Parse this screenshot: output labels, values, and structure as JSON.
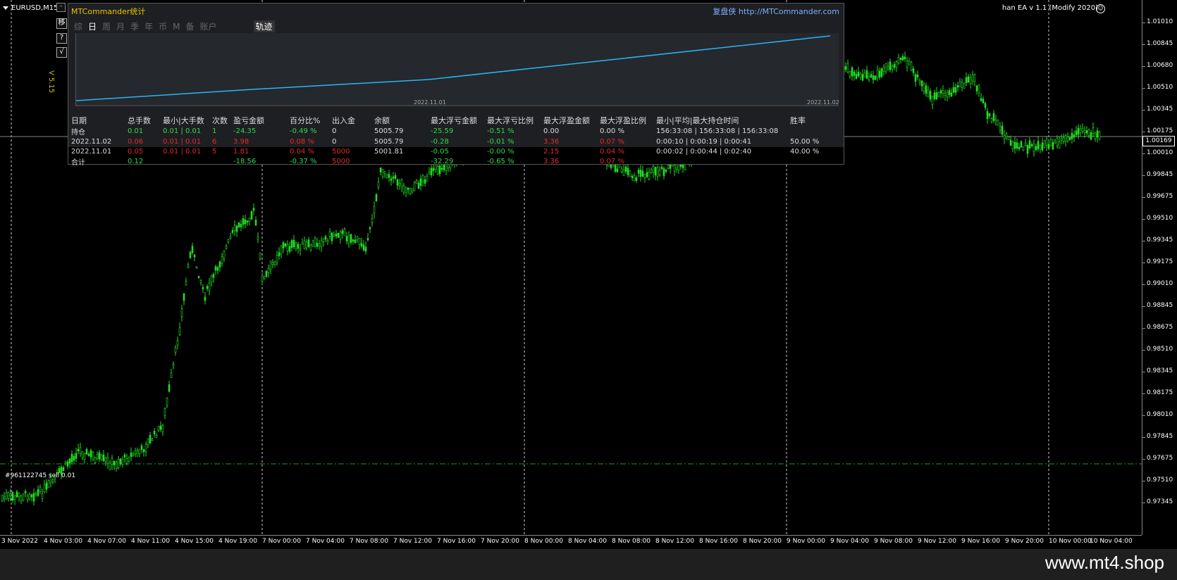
{
  "chart": {
    "symbol": "EURUSD,M15",
    "ea_label": "han EA  v 1.1 (Modify 2020)",
    "version": "V 5.15",
    "order_label": "#961122745 sell 0.01",
    "current_price": "1.00169",
    "price_ticks": [
      "1.01010",
      "1.00845",
      "1.00680",
      "1.00510",
      "1.00345",
      "1.00175",
      "1.00010",
      "0.99845",
      "0.99675",
      "0.99510",
      "0.99345",
      "0.99175",
      "0.99010",
      "0.98845",
      "0.98675",
      "0.98510",
      "0.98345",
      "0.98175",
      "0.98010",
      "0.97845",
      "0.97675",
      "0.97510",
      "0.97345"
    ],
    "time_ticks": [
      "3 Nov 2022",
      "4 Nov 03:00",
      "4 Nov 07:00",
      "4 Nov 11:00",
      "4 Nov 15:00",
      "4 Nov 19:00",
      "7 Nov 00:00",
      "7 Nov 04:00",
      "7 Nov 08:00",
      "7 Nov 12:00",
      "7 Nov 16:00",
      "7 Nov 20:00",
      "8 Nov 00:00",
      "8 Nov 04:00",
      "8 Nov 08:00",
      "8 Nov 12:00",
      "8 Nov 16:00",
      "8 Nov 20:00",
      "9 Nov 00:00",
      "9 Nov 04:00",
      "9 Nov 08:00",
      "9 Nov 12:00",
      "9 Nov 16:00",
      "9 Nov 20:00",
      "10 Nov 00:00",
      "10 Nov 04:00"
    ],
    "colors": {
      "candle": "#22dd22",
      "axis": "#888888",
      "order_line": "#2a8f2a"
    }
  },
  "side_buttons": [
    "移",
    "?",
    "√"
  ],
  "panel": {
    "title": "MTCommander统计",
    "site": "复盘侠 http://MTCommander.com",
    "tabs": [
      "综",
      "日",
      "周",
      "月",
      "季",
      "年",
      "币",
      "M",
      "备",
      "账户"
    ],
    "active_tab": "日",
    "track_tab": "轨迹",
    "mini_dates": [
      "2022.11.01",
      "2022.11.02"
    ],
    "line_color": "#29b6f6",
    "headers": [
      "日期",
      "总手数",
      "最小|大手数",
      "次数",
      "盈亏金额",
      "百分比%",
      "出入金",
      "余额",
      "最大浮亏金额",
      "最大浮亏比例",
      "最大浮盈金额",
      "最大浮盈比例",
      "最小|平均|最大持仓时间",
      "胜率"
    ],
    "rows": [
      {
        "cells": [
          "持仓",
          "0.01",
          "0.01 | 0.01",
          "1",
          "-24.35",
          "-0.49 %",
          "0",
          "5005.79",
          "-25.59",
          "-0.51 %",
          "0.00",
          "0.00 %",
          "156:33:08 | 156:33:08 | 156:33:08",
          ""
        ],
        "colors": [
          "w",
          "g",
          "g",
          "g",
          "g",
          "g",
          "w",
          "w",
          "g",
          "g",
          "w",
          "w",
          "w",
          "w"
        ]
      },
      {
        "cells": [
          "2022.11.02",
          "0.06",
          "0.01 | 0.01",
          "6",
          "3.98",
          "0.08 %",
          "0",
          "5005.79",
          "-0.28",
          "-0.01 %",
          "3.36",
          "0.07 %",
          "0:00:10 | 0:00:19 | 0:00:41",
          "50.00 %"
        ],
        "colors": [
          "w",
          "r",
          "r",
          "r",
          "r",
          "r",
          "w",
          "w",
          "g",
          "g",
          "r",
          "r",
          "w",
          "w"
        ]
      },
      {
        "cells": [
          "2022.11.01",
          "0.05",
          "0.01 | 0.01",
          "5",
          "1.81",
          "0.04 %",
          "5000",
          "5001.81",
          "-0.05",
          "-0.00 %",
          "2.15",
          "0.04 %",
          "0:00:02 | 0:00:44 | 0:02:40",
          "40.00 %"
        ],
        "colors": [
          "w",
          "r",
          "r",
          "r",
          "r",
          "r",
          "r",
          "w",
          "g",
          "g",
          "r",
          "r",
          "w",
          "w"
        ]
      },
      {
        "cells": [
          "合计",
          "0.12",
          "",
          "",
          "-18.56",
          "-0.37 %",
          "5000",
          "",
          "-32.29",
          "-0.65 %",
          "3.36",
          "0.07 %",
          "",
          ""
        ],
        "colors": [
          "w",
          "g",
          "w",
          "w",
          "g",
          "g",
          "r",
          "w",
          "g",
          "g",
          "r",
          "r",
          "w",
          "w"
        ]
      }
    ]
  },
  "watermark": "www.mt4.shop"
}
